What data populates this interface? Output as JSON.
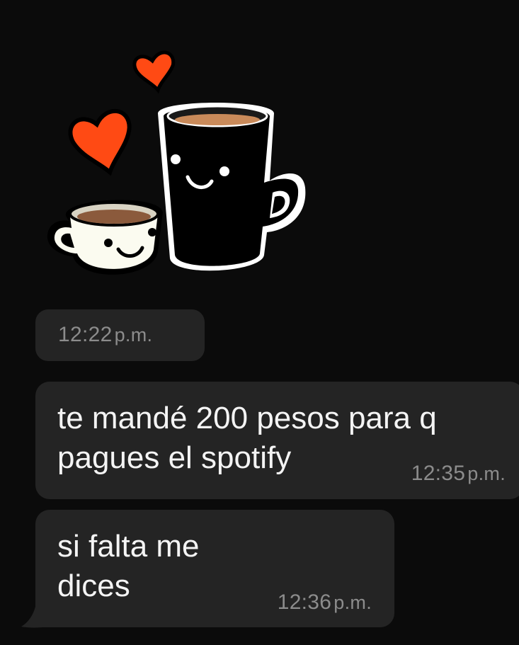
{
  "sticker": {
    "icon": "coffee-cups-hearts-sticker",
    "time": "12:22",
    "ampm": "p.m."
  },
  "messages": [
    {
      "lines": [
        "te mandé 200 pesos para q",
        "pagues el spotify"
      ],
      "time": "12:35",
      "ampm": "p.m."
    },
    {
      "lines": [
        "si falta me",
        "dices"
      ],
      "time": "12:36",
      "ampm": "p.m."
    }
  ],
  "colors": {
    "background": "#0b0b0b",
    "bubble": "#242424",
    "timestamp": "#8c8c8c",
    "heart": "#ff4a14",
    "coffee": "#8b5a3c"
  }
}
